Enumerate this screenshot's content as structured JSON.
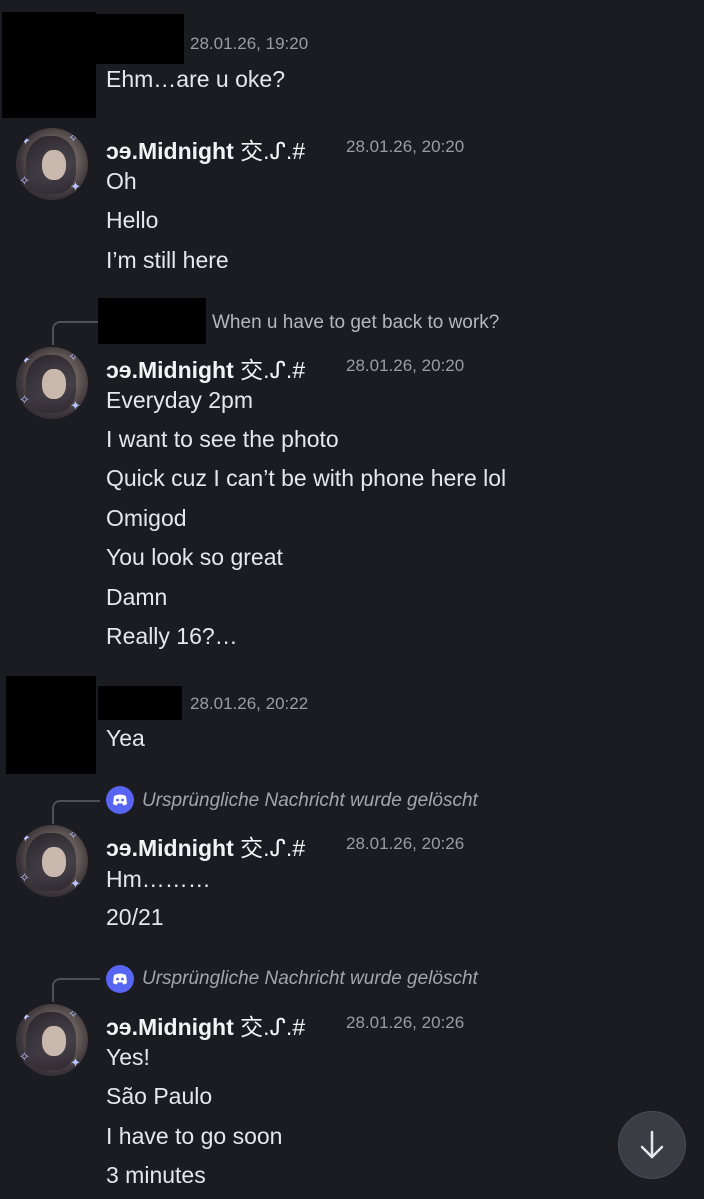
{
  "messages": [
    {
      "timestamp": "28.01.26, 19:20",
      "lines": [
        "Ehm…are u oke?"
      ]
    },
    {
      "username": "ɔɘ.Midnight",
      "username_glyph": "交.ᔑ.#",
      "timestamp": "28.01.26, 20:20",
      "lines": [
        "Oh",
        "Hello",
        "I’m still here"
      ]
    },
    {
      "reply_text": "When u have to get back to work?",
      "username": "ɔɘ.Midnight",
      "username_glyph": "交.ᔑ.#",
      "timestamp": "28.01.26, 20:20",
      "lines": [
        "Everyday 2pm",
        "I want to see the photo",
        "Quick cuz I can’t be with phone here lol",
        "Omigod",
        "You look so great",
        "Damn",
        "Really 16?…"
      ]
    },
    {
      "timestamp": "28.01.26, 20:22",
      "lines": [
        "Yea"
      ]
    },
    {
      "reply_text": "Ursprüngliche Nachricht wurde gelöscht",
      "username": "ɔɘ.Midnight",
      "username_glyph": "交.ᔑ.#",
      "timestamp": "28.01.26, 20:26",
      "lines": [
        "Hm………",
        "20/21"
      ]
    },
    {
      "reply_text": "Ursprüngliche Nachricht wurde gelöscht",
      "username": "ɔɘ.Midnight",
      "username_glyph": "交.ᔑ.#",
      "timestamp": "28.01.26, 20:26",
      "lines": [
        "Yes!",
        "São Paulo",
        "I have to go soon",
        "3 minutes"
      ]
    }
  ],
  "icons": {
    "scroll_to_bottom": "arrow-down-icon",
    "deleted_reply": "discord-icon",
    "avatar_decoration": "star-icon"
  },
  "colors": {
    "background": "#1b1c21",
    "accent": "#5865f2",
    "timestamp": "#9a9ca4"
  }
}
